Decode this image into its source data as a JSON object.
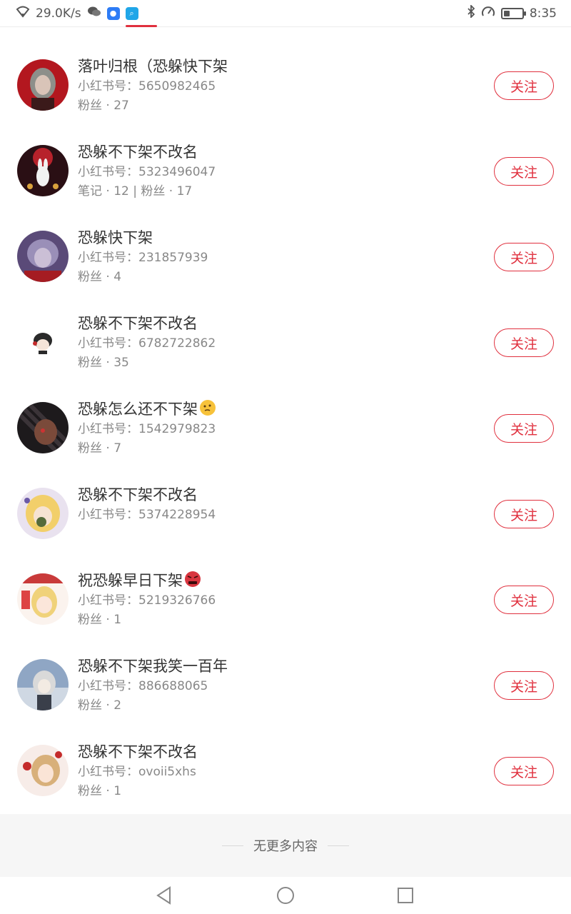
{
  "status_bar": {
    "net_speed": "29.0K/s",
    "time": "8:35",
    "battery_level": 0.35,
    "icons": [
      "wifi-icon",
      "wechat-icon",
      "bulb-app-icon",
      "search-app-icon",
      "bluetooth-icon",
      "speed-icon",
      "battery-icon"
    ]
  },
  "users": [
    {
      "name": "落叶归根（恐躲快下架",
      "id_label": "小红书号：",
      "id": "5650982465",
      "stats": "粉丝 · 27",
      "emoji": ""
    },
    {
      "name": "恐躲不下架不改名",
      "id_label": "小红书号：",
      "id": "5323496047",
      "stats": "笔记 · 12 | 粉丝 · 17",
      "emoji": ""
    },
    {
      "name": "恐躲快下架",
      "id_label": "小红书号：",
      "id": "231857939",
      "stats": "粉丝 · 4",
      "emoji": ""
    },
    {
      "name": "恐躲不下架不改名",
      "id_label": "小红书号：",
      "id": "6782722862",
      "stats": "粉丝 · 35",
      "emoji": ""
    },
    {
      "name": "恐躲怎么还不下架",
      "id_label": "小红书号：",
      "id": "1542979823",
      "stats": "粉丝 · 7",
      "emoji": "thinking-emoji"
    },
    {
      "name": "恐躲不下架不改名",
      "id_label": "小红书号：",
      "id": "5374228954",
      "stats": "",
      "emoji": ""
    },
    {
      "name": "祝恐躲早日下架",
      "id_label": "小红书号：",
      "id": "5219326766",
      "stats": "粉丝 · 1",
      "emoji": "angry-emoji"
    },
    {
      "name": "恐躲不下架我笑一百年",
      "id_label": "小红书号：",
      "id": "886688065",
      "stats": "粉丝 · 2",
      "emoji": ""
    },
    {
      "name": "恐躲不下架不改名",
      "id_label": "小红书号：",
      "id": "ovoii5xhs",
      "stats": "粉丝 · 1",
      "emoji": ""
    }
  ],
  "follow_label": "关注",
  "footer_text": "无更多内容",
  "colors": {
    "accent": "#e0303e",
    "text": "#333333",
    "subtext": "#888888"
  }
}
